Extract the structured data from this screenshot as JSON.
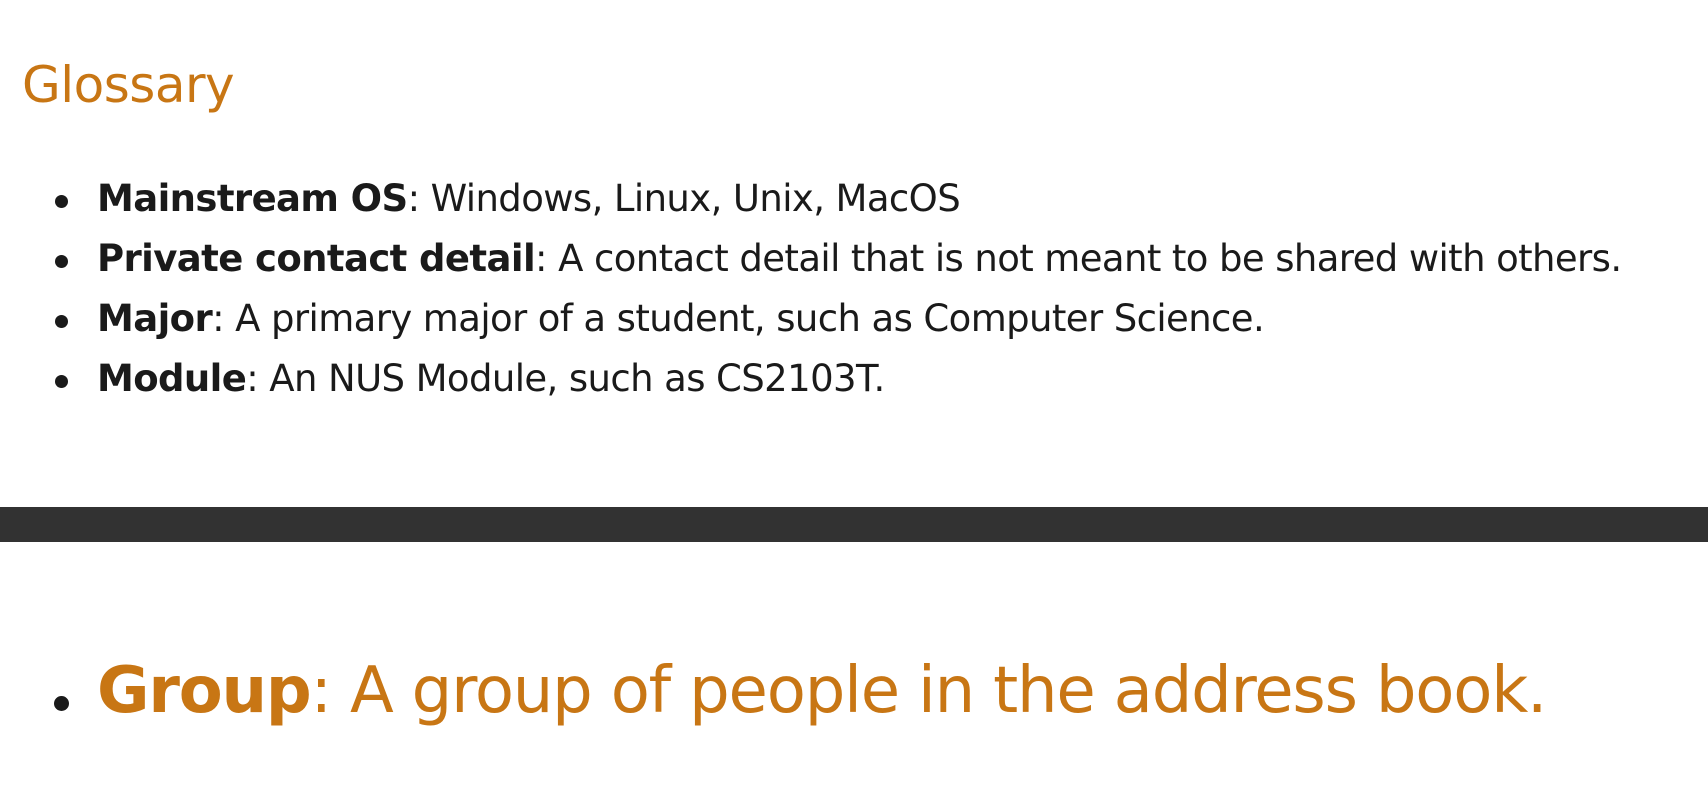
{
  "heading": "Glossary",
  "glossary": [
    {
      "term": "Mainstream OS",
      "definition": ": Windows, Linux, Unix, MacOS"
    },
    {
      "term": "Private contact detail",
      "definition": ": A contact detail that is not meant to be shared with others."
    },
    {
      "term": "Major",
      "definition": ": A primary major of a student, such as Computer Science."
    },
    {
      "term": "Module",
      "definition": ": An NUS Module, such as CS2103T."
    }
  ],
  "featured": {
    "term": "Group",
    "definition": ": A group of people in the address book."
  },
  "colors": {
    "accent": "#c87614",
    "text": "#1a1a1a",
    "divider": "#323232",
    "background": "#ffffff"
  }
}
